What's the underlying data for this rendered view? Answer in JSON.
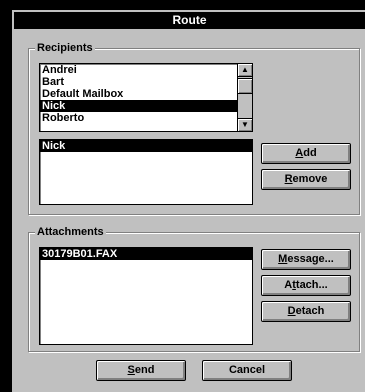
{
  "window": {
    "title": "Route"
  },
  "recipients": {
    "legend": "Recipients",
    "address_list": [
      "Andrei",
      "Bart",
      "Default Mailbox",
      "Nick",
      "Roberto"
    ],
    "address_selected_index": 3,
    "routing_list": [
      "Nick"
    ],
    "add_label_u": "A",
    "add_label_rest": "dd",
    "remove_label_u": "R",
    "remove_label_rest": "emove"
  },
  "attachments": {
    "legend": "Attachments",
    "files": [
      "30179B01.FAX"
    ],
    "message_label_u": "M",
    "message_label_rest": "essage...",
    "attach_label_pre": "A",
    "attach_label_u": "t",
    "attach_label_rest": "tach...",
    "detach_label_u": "D",
    "detach_label_rest": "etach"
  },
  "footer": {
    "send_label_u": "S",
    "send_label_rest": "end",
    "cancel_label": "Cancel"
  }
}
